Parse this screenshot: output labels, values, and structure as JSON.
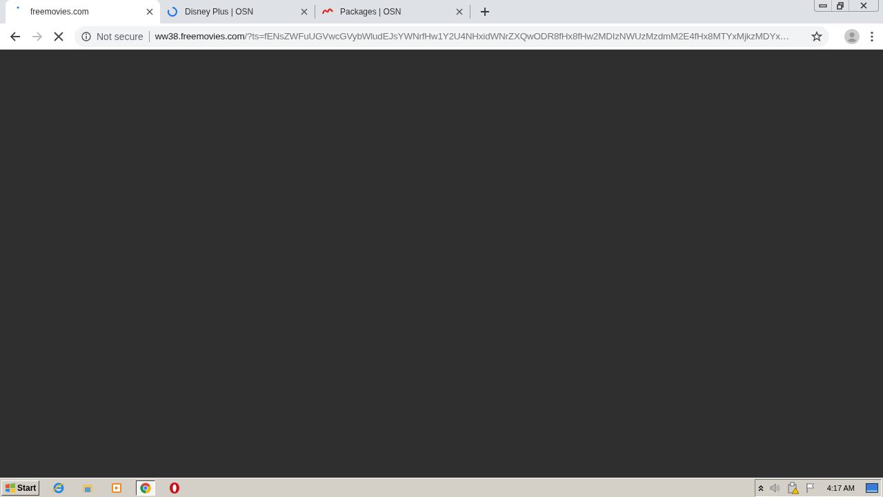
{
  "tabs": [
    {
      "title": "freemovies.com",
      "kind": "dot",
      "selected": true
    },
    {
      "title": "Disney Plus | OSN",
      "kind": "spinner",
      "selected": false
    },
    {
      "title": "Packages | OSN",
      "kind": "logo",
      "selected": false
    }
  ],
  "toolbar": {
    "security": "Not secure",
    "url_host": "ww38.freemovies.com",
    "url_rest": "/?ts=fENsZWFuUGVwcGVybWludEJsYWNrfHw1Y2U4NHxidWNrZXQwODR8fHx8fHw2MDIzNWUzMzdmM2E4fHx8MTYxMjkzMDYx…",
    "loading": true
  },
  "taskbar": {
    "start": "Start",
    "apps": [
      {
        "kind": "ie",
        "selected": false
      },
      {
        "kind": "folder",
        "selected": false
      },
      {
        "kind": "media",
        "selected": false
      },
      {
        "kind": "chrome",
        "selected": true
      },
      {
        "kind": "opera",
        "selected": false
      }
    ],
    "clock": "4:17 AM"
  }
}
